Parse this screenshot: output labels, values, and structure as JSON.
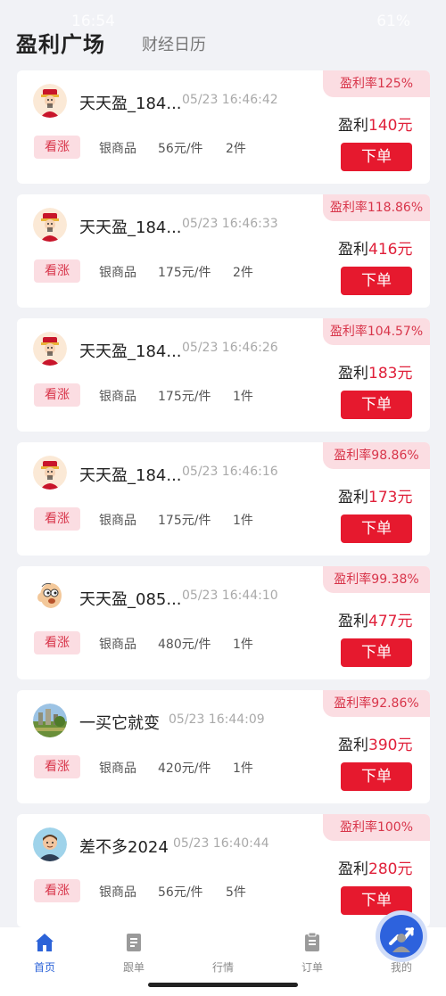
{
  "status_bar": {
    "time": "16:54",
    "indicators": "61%"
  },
  "header": {
    "title": "盈利广场",
    "tab2": "财经日历"
  },
  "trades": [
    {
      "avatar": "caishen-avatar",
      "user": "天天盈_184...",
      "time": "05/23 16:46:42",
      "tag": "看涨",
      "category": "银商品",
      "price": "56元/件",
      "qty": "2件",
      "rate": "盈利率125%",
      "profit_label": "盈利",
      "amount": "140元",
      "button": "下单"
    },
    {
      "avatar": "caishen-avatar",
      "user": "天天盈_184...",
      "time": "05/23 16:46:33",
      "tag": "看涨",
      "category": "银商品",
      "price": "175元/件",
      "qty": "2件",
      "rate": "盈利率118.86%",
      "profit_label": "盈利",
      "amount": "416元",
      "button": "下单"
    },
    {
      "avatar": "caishen-avatar",
      "user": "天天盈_184...",
      "time": "05/23 16:46:26",
      "tag": "看涨",
      "category": "银商品",
      "price": "175元/件",
      "qty": "1件",
      "rate": "盈利率104.57%",
      "profit_label": "盈利",
      "amount": "183元",
      "button": "下单"
    },
    {
      "avatar": "caishen-avatar",
      "user": "天天盈_184...",
      "time": "05/23 16:46:16",
      "tag": "看涨",
      "category": "银商品",
      "price": "175元/件",
      "qty": "1件",
      "rate": "盈利率98.86%",
      "profit_label": "盈利",
      "amount": "173元",
      "button": "下单"
    },
    {
      "avatar": "cartoon-face-avatar",
      "user": "天天盈_085...",
      "time": "05/23 16:44:10",
      "tag": "看涨",
      "category": "银商品",
      "price": "480元/件",
      "qty": "1件",
      "rate": "盈利率99.38%",
      "profit_label": "盈利",
      "amount": "477元",
      "button": "下单"
    },
    {
      "avatar": "landscape-avatar",
      "user": "一买它就变",
      "time": "05/23 16:44:09",
      "tag": "看涨",
      "category": "银商品",
      "price": "420元/件",
      "qty": "1件",
      "rate": "盈利率92.86%",
      "profit_label": "盈利",
      "amount": "390元",
      "button": "下单"
    },
    {
      "avatar": "man-avatar",
      "user": "差不多2024",
      "time": "05/23 16:40:44",
      "tag": "看涨",
      "category": "银商品",
      "price": "56元/件",
      "qty": "5件",
      "rate": "盈利率100%",
      "profit_label": "盈利",
      "amount": "280元",
      "button": "下单"
    }
  ],
  "tabbar": {
    "home": "首页",
    "follow": "跟单",
    "market": "行情",
    "orders": "订单",
    "mine": "我的"
  },
  "colors": {
    "accent": "#e6192e",
    "tab_active": "#2c63d8",
    "tag_bg": "#fbdde2"
  }
}
